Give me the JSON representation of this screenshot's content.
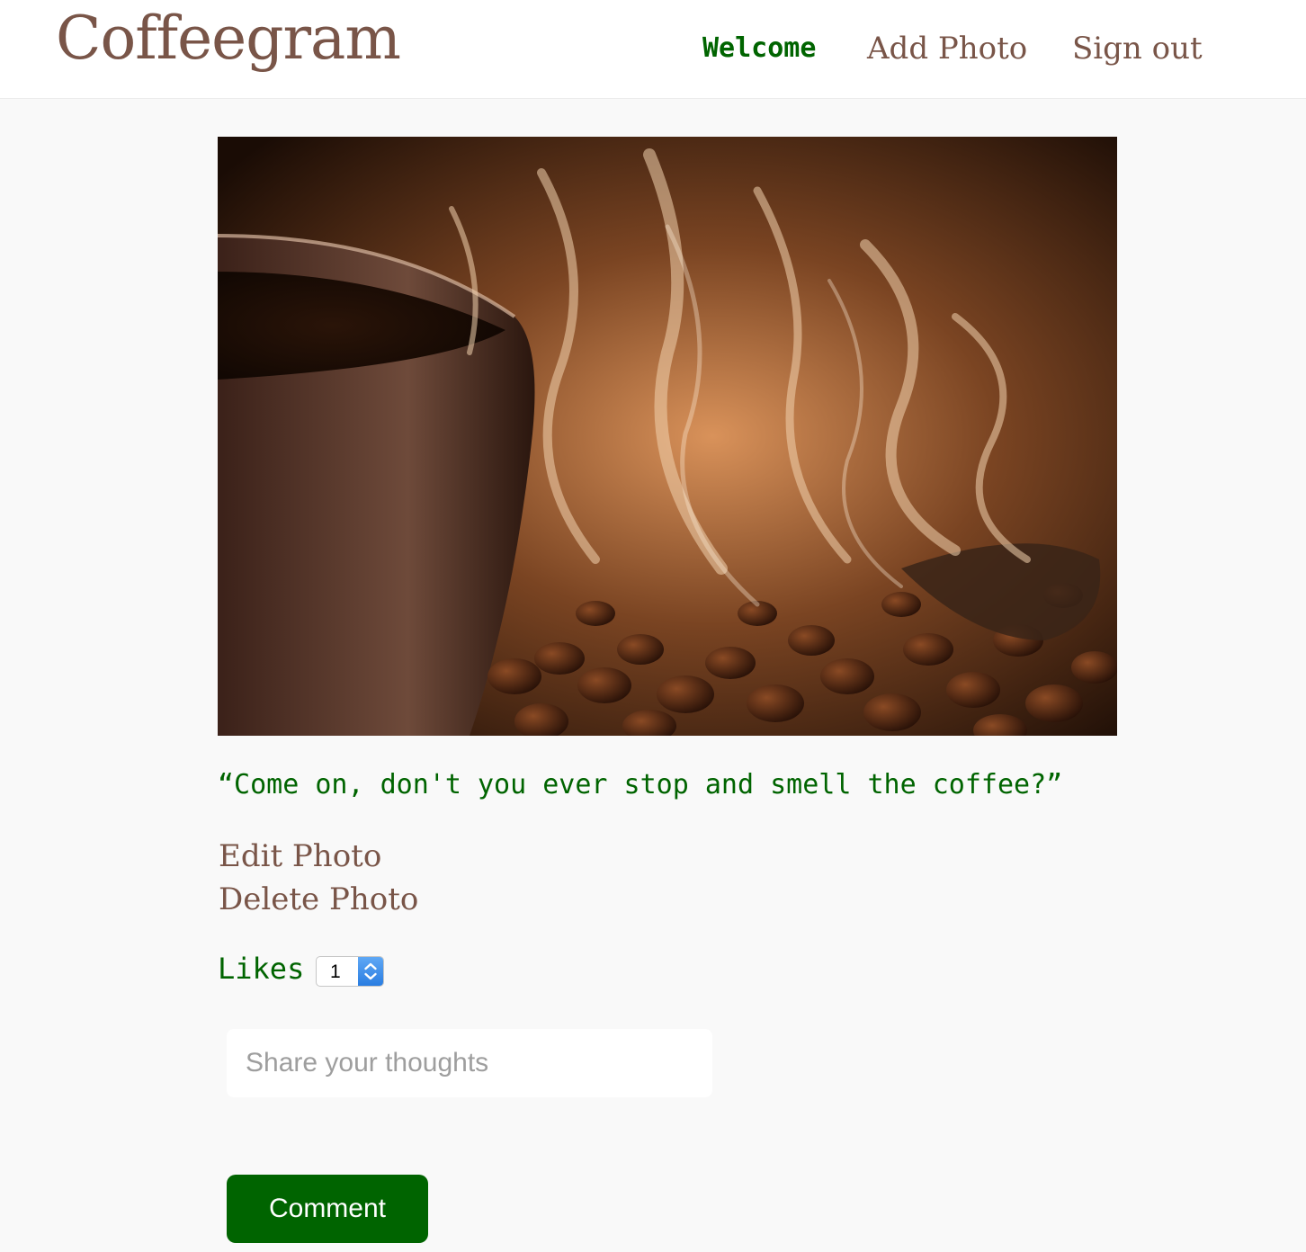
{
  "header": {
    "brand": "Coffeegram",
    "nav": {
      "welcome": "Welcome",
      "add_photo": "Add Photo",
      "sign_out": "Sign out"
    }
  },
  "photo": {
    "caption": "“Come on, don't you ever stop and smell the coffee?”"
  },
  "actions": {
    "edit": "Edit Photo",
    "delete": "Delete Photo"
  },
  "likes": {
    "label": "Likes",
    "value": "1"
  },
  "comment_form": {
    "placeholder": "Share your thoughts",
    "submit_label": "Comment"
  },
  "colors": {
    "brand": "#795548",
    "accent_green": "#006400",
    "page_background": "#f9f9f9"
  }
}
